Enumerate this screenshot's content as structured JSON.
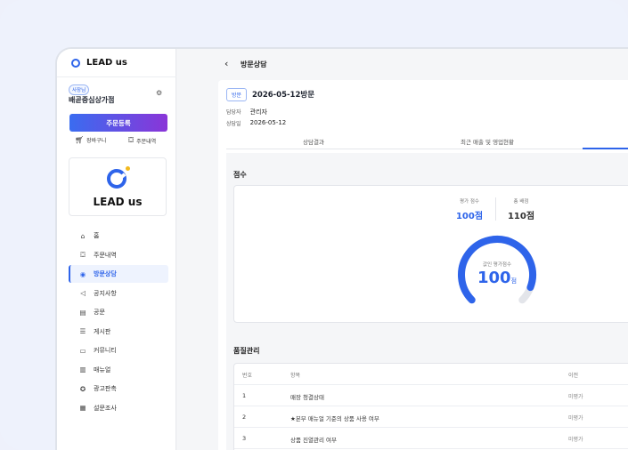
{
  "brand": {
    "name": "LEAD us"
  },
  "store": {
    "role_badge": "사장님",
    "name": "배곧중심상가점"
  },
  "sidebar": {
    "order_button": "주문등록",
    "cart_label": "장바구니",
    "orders_label": "주문내역",
    "logo_text": "LEAD us",
    "items": [
      {
        "label": "홈",
        "icon": "home-icon"
      },
      {
        "label": "주문내역",
        "icon": "box-icon"
      },
      {
        "label": "방문상담",
        "icon": "location-icon",
        "active": true
      },
      {
        "label": "공지사항",
        "icon": "megaphone-icon"
      },
      {
        "label": "공문",
        "icon": "document-icon"
      },
      {
        "label": "게시판",
        "icon": "list-icon"
      },
      {
        "label": "커뮤니티",
        "icon": "chat-icon"
      },
      {
        "label": "매뉴얼",
        "icon": "book-icon"
      },
      {
        "label": "광고판촉",
        "icon": "badge-icon"
      },
      {
        "label": "설문조사",
        "icon": "survey-icon"
      }
    ]
  },
  "header": {
    "title": "방문상담"
  },
  "visit": {
    "badge": "방문",
    "title": "2026-05-12방문",
    "manager_label": "담당자",
    "manager": "관리자",
    "date_label": "상담일",
    "date": "2026-05-12"
  },
  "tabs": [
    {
      "label": "상담결과"
    },
    {
      "label": "최근 매출 및 영업현황"
    }
  ],
  "score": {
    "section_title": "점수",
    "eval_label": "평가 점수",
    "eval_value": "100점",
    "total_label": "총 배점",
    "total_value": "110점",
    "converted_label": "값인 평가점수",
    "converted_value": "100",
    "converted_unit": "점",
    "gauge_fraction": 0.91
  },
  "quality": {
    "section_title": "품질관리",
    "columns": [
      "번호",
      "항목",
      "이전"
    ],
    "rows": [
      {
        "no": "1",
        "item": "매장 청결상태",
        "prev": "미평가"
      },
      {
        "no": "2",
        "item": "★본부 매뉴얼 기준의 상품 사용 여부",
        "prev": "미평가"
      },
      {
        "no": "3",
        "item": "상품 진열관리 여부",
        "prev": "미평가"
      }
    ]
  },
  "colors": {
    "accent": "#2e64ea",
    "gradient_end": "#8a35d8"
  }
}
